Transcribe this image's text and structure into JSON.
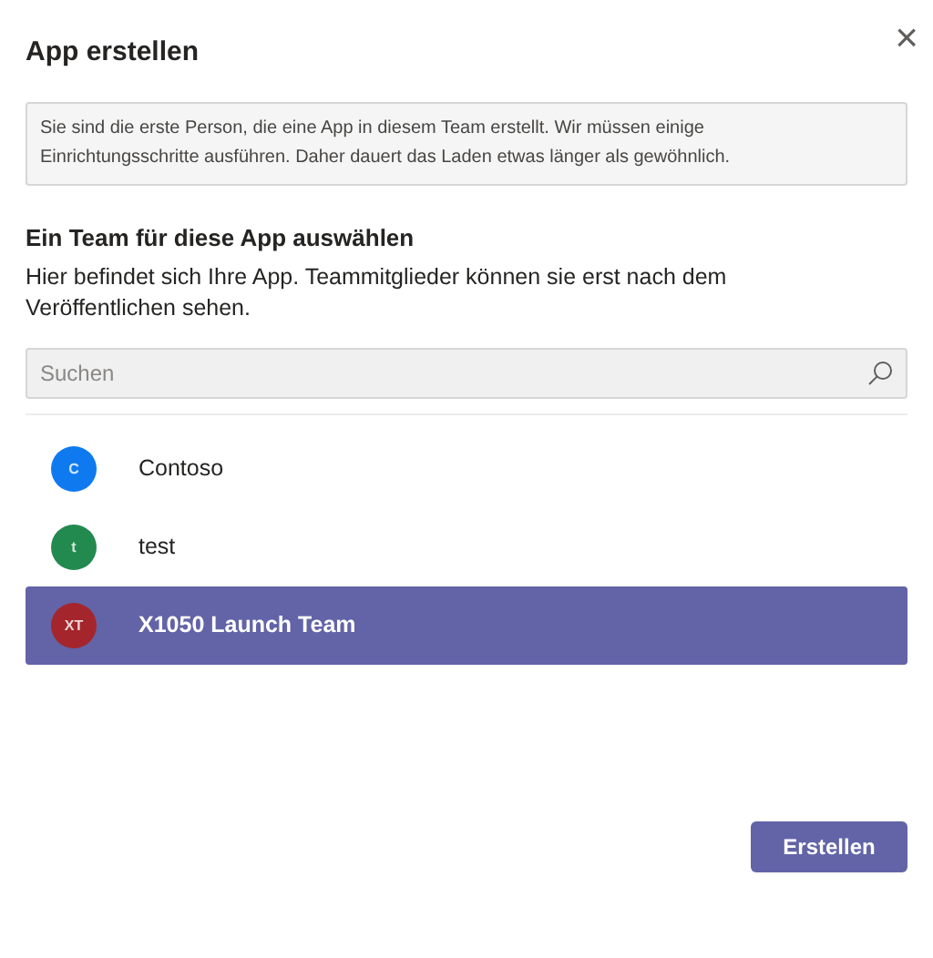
{
  "dialog": {
    "title": "App erstellen",
    "close": "×"
  },
  "notice": "Sie sind die erste Person, die eine App in diesem Team erstellt. Wir müssen einige Einrichtungsschritte ausführen. Daher dauert das Laden etwas länger als gewöhnlich.",
  "section": {
    "heading": "Ein Team für diese App auswählen",
    "description": "Hier befindet sich Ihre App. Teammitglieder können sie erst nach dem Veröffentlichen sehen."
  },
  "search": {
    "placeholder": "Suchen"
  },
  "teams": [
    {
      "initials": "C",
      "name": "Contoso",
      "color": "#0f7af0",
      "selected": false
    },
    {
      "initials": "t",
      "name": "test",
      "color": "#228a4e",
      "selected": false
    },
    {
      "initials": "XT",
      "name": "X1050 Launch Team",
      "color": "#a4262c",
      "selected": true
    }
  ],
  "buttons": [
    {
      "label": "Erstellen"
    }
  ]
}
